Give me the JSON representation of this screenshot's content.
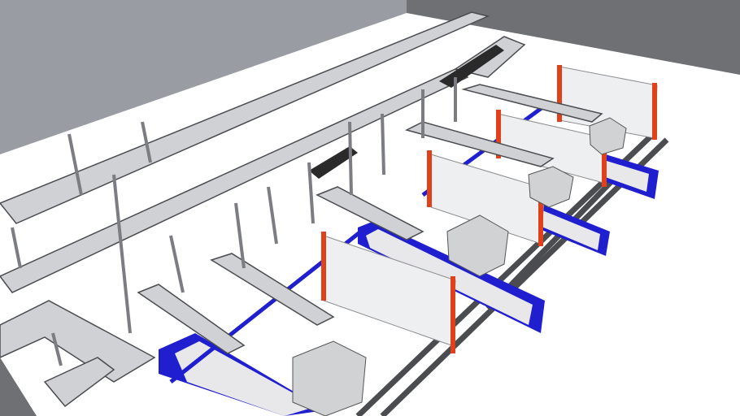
{
  "scene": {
    "subject": "conveyor-system-3d-model",
    "colors": {
      "floor": "#ffffff",
      "wall_left": "#9a9ca3",
      "wall_right": "#6e7073",
      "steel": "#a7aab0",
      "steel_dark": "#4a4c50",
      "blue_conveyor": "#1f1fd0",
      "orange_post": "#e0401a",
      "fence": "#d8dadc",
      "machine": "#d0d2d4",
      "belt_dark": "#2a2a2a"
    }
  }
}
